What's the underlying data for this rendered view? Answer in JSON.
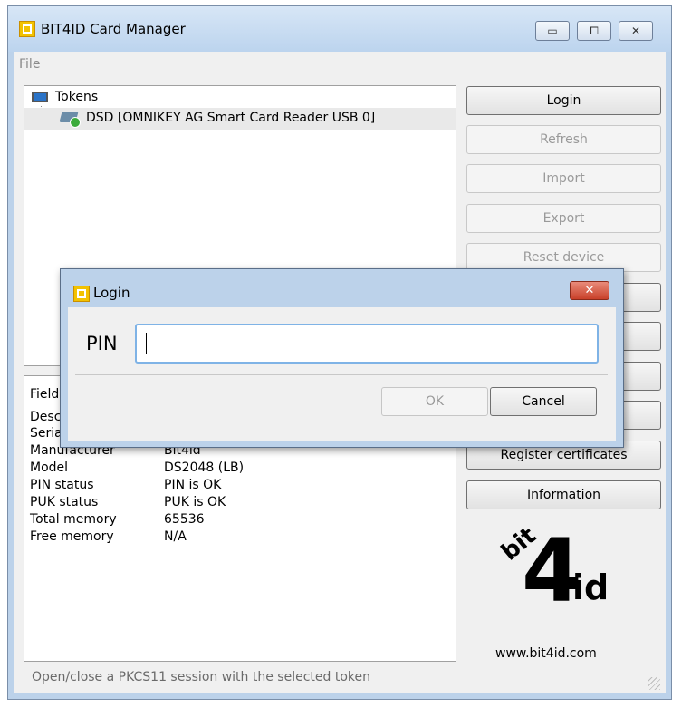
{
  "window": {
    "title": "BIT4ID Card Manager",
    "minimize": "▭",
    "maximize": "⧠",
    "close": "✕"
  },
  "menu": {
    "file": "File"
  },
  "tree": {
    "root": "Tokens",
    "child": "DSD [OMNIKEY AG Smart Card Reader USB 0]"
  },
  "fields": {
    "header": "Field",
    "rows": [
      {
        "key": "Desc",
        "value": ""
      },
      {
        "key": "Seria",
        "value": ""
      },
      {
        "key": "Manufacturer",
        "value": "Bit4id"
      },
      {
        "key": "Model",
        "value": "DS2048 (LB)"
      },
      {
        "key": "PIN status",
        "value": "PIN is OK"
      },
      {
        "key": "PUK status",
        "value": "PUK is OK"
      },
      {
        "key": "Total memory",
        "value": "65536"
      },
      {
        "key": "Free memory",
        "value": "N/A"
      }
    ]
  },
  "buttons": {
    "login": "Login",
    "refresh": "Refresh",
    "import": "Import",
    "export": "Export",
    "reset_device": "Reset device",
    "register_certificates": "Register certificates",
    "information": "Information"
  },
  "logo": {
    "bit": "bit",
    "four": "4",
    "id": "id"
  },
  "website": "www.bit4id.com",
  "status": "Open/close a PKCS11 session with the selected token",
  "dialog": {
    "title": "Login",
    "close": "✕",
    "pin_label": "PIN",
    "pin_value": "",
    "ok": "OK",
    "cancel": "Cancel"
  },
  "colors": {
    "titlebar": "#bcd2ea",
    "close_red": "#c8402a",
    "focus": "#7fb3e6"
  }
}
